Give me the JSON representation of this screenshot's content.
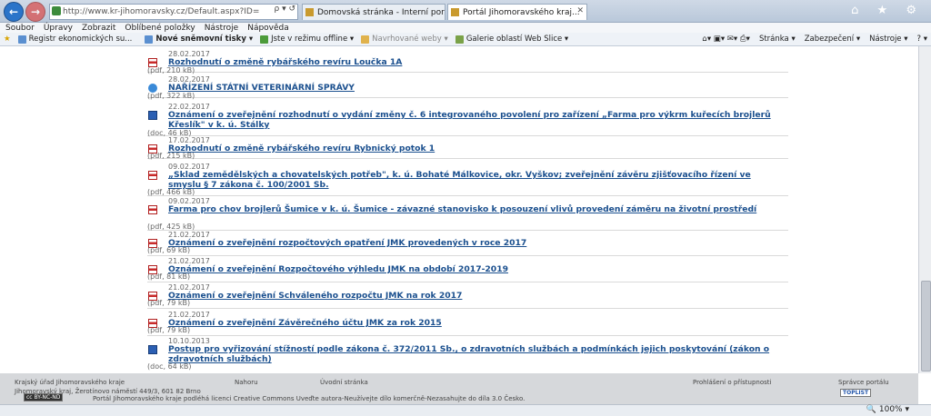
{
  "browser": {
    "address": "http://www.kr-jihomoravsky.cz/Default.aspx?ID=",
    "address_buttons": "ρ ▾ ↺",
    "tabs": [
      {
        "label": "Domovská stránka - Interní por..."
      },
      {
        "label": "Portál Jihomoravského kraj...",
        "close": "✕"
      }
    ],
    "title_icons": "⌂ ★ ⚙"
  },
  "menu": [
    "Soubor",
    "Úpravy",
    "Zobrazit",
    "Oblíbené položky",
    "Nástroje",
    "Nápověda"
  ],
  "favorites": [
    {
      "label": "Registr ekonomických su..."
    },
    {
      "label": "Nové sněmovní tisky ▾",
      "bold": true
    },
    {
      "label": "Jste v režimu offline ▾"
    },
    {
      "label": "Navrhované weby ▾",
      "muted": true
    },
    {
      "label": "Galerie oblastí Web Slice ▾"
    }
  ],
  "command_bar": [
    "Stránka ▾",
    "Zabezpečení ▾",
    "Nástroje ▾",
    "? ▾"
  ],
  "items": [
    {
      "date": "28.02.2017",
      "title": "Rozhodnutí o změně rybářského revíru Loučka 1A",
      "meta": "(pdf, 210 kB)",
      "icon": "pdf"
    },
    {
      "date": "28.02.2017",
      "title": "NAŘÍZENÍ STÁTNÍ VETERINÁRNÍ SPRÁVY",
      "meta": "(pdf, 322 kB)",
      "icon": "ie"
    },
    {
      "date": "22.02.2017",
      "title": "Oznámení o zveřejnění rozhodnutí o vydání změny č. 6 integrovaného povolení pro zařízení „Farma pro výkrm kuřecích brojlerů Křeslík\" v k. ú. Stálky",
      "meta": "(doc, 46 kB)",
      "icon": "doc"
    },
    {
      "date": "17.02.2017",
      "title": "Rozhodnutí o změně rybářského revíru Rybnický potok 1",
      "meta": "(pdf, 215 kB)",
      "icon": "pdf"
    },
    {
      "date": "09.02.2017",
      "title": "„Sklad zemědělských a chovatelských potřeb\", k. ú. Bohaté Málkovice, okr. Vyškov; zveřejnění závěru zjišťovacího řízení ve smyslu § 7 zákona č. 100/2001 Sb.",
      "meta": "(pdf, 466 kB)",
      "icon": "pdf"
    },
    {
      "date": "09.02.2017",
      "title": "Farma pro chov brojlerů Šumice v k. ú. Šumice - závazné stanovisko k posouzení vlivů provedení záměru na životní prostředí",
      "meta": "(pdf, 425 kB)",
      "icon": "pdf"
    },
    {
      "date": "21.02.2017",
      "title": "Oznámení o zveřejnění rozpočtových opatření JMK provedených v roce 2017",
      "meta": "(pdf, 69 kB)",
      "icon": "pdf"
    },
    {
      "date": "21.02.2017",
      "title": "Oznámení o zveřejnění Rozpočtového výhledu JMK na období 2017-2019",
      "meta": "(pdf, 81 kB)",
      "icon": "pdf"
    },
    {
      "date": "21.02.2017",
      "title": "Oznámení o zveřejnění Schváleného rozpočtu JMK na rok 2017",
      "meta": "(pdf, 79 kB)",
      "icon": "pdf"
    },
    {
      "date": "21.02.2017",
      "title": "Oznámení o zveřejnění Závěrečného účtu JMK za rok 2015",
      "meta": "(pdf, 79 kB)",
      "icon": "pdf"
    },
    {
      "date": "10.10.2013",
      "title": "Postup pro vyřizování stížností podle zákona č. 372/2011 Sb., o zdravotních službách a podmínkách jejich poskytování (zákon o zdravotních službách)",
      "meta": "(doc, 64 kB)",
      "icon": "doc"
    }
  ],
  "footer": {
    "org": "Krajský úřad Jihomoravského kraje",
    "address": "Jihomoravský kraj, Žerotínovo náměstí 449/3, 601 82 Brno",
    "nahoru": "Nahoru",
    "home": "Úvodní stránka",
    "accessibility": "Prohlášení o přístupnosti",
    "admin": "Správce portálu",
    "license_badge": "cc BY-NC-ND",
    "license_text": "Portál Jihomoravského kraje podléhá licenci    Creative Commons Uveďte autora-Neužívejte dílo komerčně-Nezasahujte do díla 3.0 Česko.",
    "toplist": "TOPLIST"
  },
  "status": {
    "zoom": "🔍 100% ▾"
  }
}
